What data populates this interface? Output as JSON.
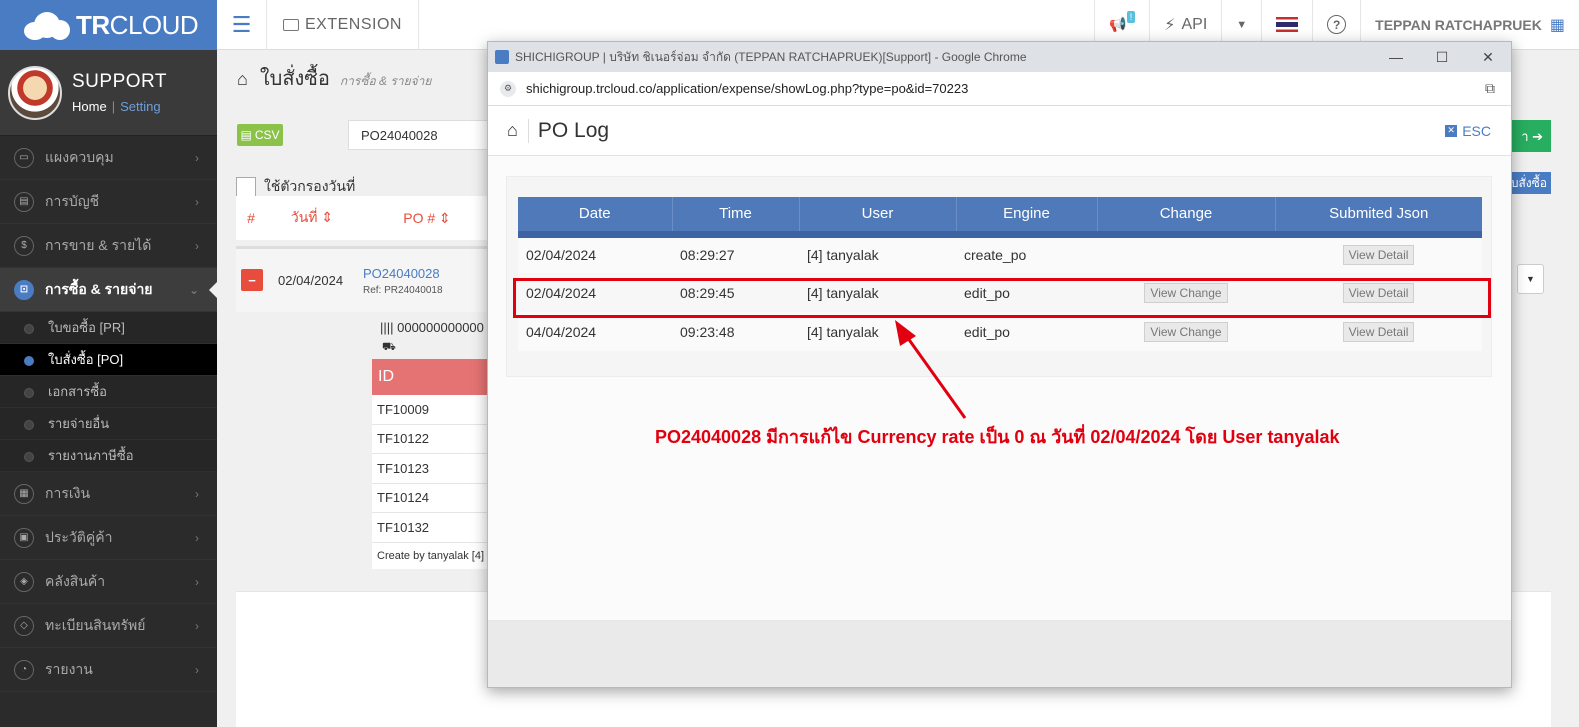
{
  "brand": {
    "logo_bold": "TR",
    "logo_light": "CLOUD"
  },
  "profile": {
    "name": "SUPPORT",
    "home": "Home",
    "sep": "|",
    "setting": "Setting"
  },
  "sidebar": {
    "items": [
      {
        "label": "แผงควบคุม"
      },
      {
        "label": "การบัญชี"
      },
      {
        "label": "การขาย & รายได้"
      },
      {
        "label": "การซื้อ & รายจ่าย"
      },
      {
        "label": "การเงิน"
      },
      {
        "label": "ประวัติคู่ค้า"
      },
      {
        "label": "คลังสินค้า"
      },
      {
        "label": "ทะเบียนสินทรัพย์"
      },
      {
        "label": "รายงาน"
      }
    ],
    "sub_items": [
      {
        "label": "ใบขอซื้อ [PR]"
      },
      {
        "label": "ใบสั่งซื้อ [PO]"
      },
      {
        "label": "เอกสารซื้อ"
      },
      {
        "label": "รายจ่ายอื่น"
      },
      {
        "label": "รายงานภาษีซื้อ"
      }
    ]
  },
  "topbar": {
    "extension": "EXTENSION",
    "badge": "!",
    "api": "API",
    "user": "TEPPAN RATCHAPRUEK"
  },
  "page": {
    "title": "ใบสั่งซื้อ",
    "subtitle": "การซื้อ & รายจ่าย",
    "csv": "CSV",
    "search_value": "PO24040028",
    "filter_label": "ใช้ตัวกรองวันที่",
    "headers": {
      "hash": "#",
      "date": "วันที่ ⇕",
      "po": "PO # ⇕"
    },
    "row": {
      "date": "02/04/2024",
      "po": "PO24040028",
      "ref": "Ref: PR24040018"
    },
    "barcode": "|||| 000000000000",
    "detail_header": "ID",
    "ids": [
      "TF10009",
      "TF10122",
      "TF10123",
      "TF10124",
      "TF10132"
    ],
    "create_by": "Create by tanyalak [4]",
    "right_btn": "า ➔",
    "right_tag": "ใบสั่งซื้อ"
  },
  "popup": {
    "window_title": "SHICHIGROUP | บริษัท ชิเนอร์จ่อม จำกัด (TEPPAN RATCHAPRUEK)[Support] - Google Chrome",
    "url": "shichigroup.trcloud.co/application/expense/showLog.php?type=po&id=70223",
    "log_title": "PO Log",
    "esc": "ESC",
    "columns": [
      "Date",
      "Time",
      "User",
      "Engine",
      "Change",
      "Submited Json"
    ],
    "rows": [
      {
        "date": "02/04/2024",
        "time": "08:29:27",
        "user": "[4] tanyalak",
        "engine": "create_po",
        "change": "",
        "json": "View Detail"
      },
      {
        "date": "02/04/2024",
        "time": "08:29:45",
        "user": "[4] tanyalak",
        "engine": "edit_po",
        "change": "View Change",
        "json": "View Detail"
      },
      {
        "date": "04/04/2024",
        "time": "09:23:48",
        "user": "[4] tanyalak",
        "engine": "edit_po",
        "change": "View Change",
        "json": "View Detail"
      }
    ]
  },
  "annotation": {
    "text": "PO24040028 มีการแก้ไข Currency rate เป็น 0 ณ วันที่ 02/04/2024 โดย User tanyalak",
    "color": "#e0000f"
  },
  "colors": {
    "brand": "#4a7cc4",
    "sidebar": "#2b2b2b",
    "header": "#4f79b8",
    "danger": "#e74c3c",
    "success": "#27ae60",
    "highlight": "#e0000f"
  }
}
